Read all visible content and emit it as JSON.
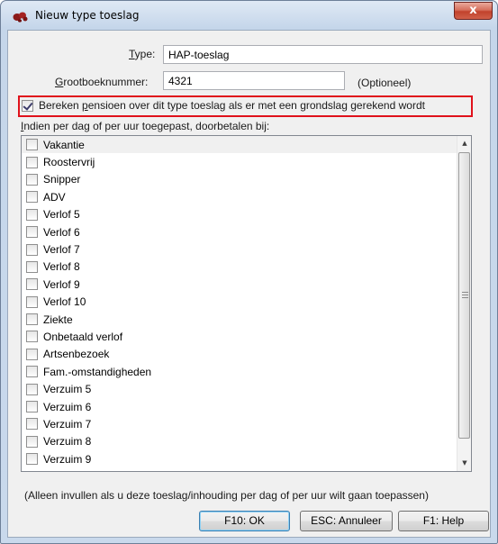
{
  "window": {
    "title": "Nieuw type toeslag",
    "close_symbol": "x"
  },
  "form": {
    "type_label_prefix": "T",
    "type_label_rest": "ype:",
    "type_value": "HAP-toeslag",
    "ledger_label_prefix": "G",
    "ledger_label_rest": "rootboeknummer:",
    "ledger_value": "4321",
    "ledger_hint": "(Optioneel)",
    "pension_checkbox": {
      "checked": true,
      "label_before": "Bereken ",
      "label_accel": "p",
      "label_after": "ensioen over dit type toeslag als er met een grondslag gerekend wordt"
    },
    "list_caption_prefix": "I",
    "list_caption_rest": "ndien per dag of per uur toegepast, doorbetalen bij:"
  },
  "leave_types": [
    {
      "label": "Vakantie",
      "checked": false
    },
    {
      "label": "Roostervrij",
      "checked": false
    },
    {
      "label": "Snipper",
      "checked": false
    },
    {
      "label": "ADV",
      "checked": false
    },
    {
      "label": "Verlof 5",
      "checked": false
    },
    {
      "label": "Verlof 6",
      "checked": false
    },
    {
      "label": "Verlof 7",
      "checked": false
    },
    {
      "label": "Verlof 8",
      "checked": false
    },
    {
      "label": "Verlof 9",
      "checked": false
    },
    {
      "label": "Verlof 10",
      "checked": false
    },
    {
      "label": "Ziekte",
      "checked": false
    },
    {
      "label": "Onbetaald verlof",
      "checked": false
    },
    {
      "label": "Artsenbezoek",
      "checked": false
    },
    {
      "label": "Fam.-omstandigheden",
      "checked": false
    },
    {
      "label": "Verzuim 5",
      "checked": false
    },
    {
      "label": "Verzuim 6",
      "checked": false
    },
    {
      "label": "Verzuim 7",
      "checked": false
    },
    {
      "label": "Verzuim 8",
      "checked": false
    },
    {
      "label": "Verzuim 9",
      "checked": false
    }
  ],
  "footer_note": "(Alleen invullen als u deze toeslag/inhouding per dag of per uur wilt gaan toepassen)",
  "buttons": {
    "ok": "F10: OK",
    "cancel": "ESC: Annuleer",
    "help": "F1: Help"
  },
  "colors": {
    "highlight_border": "#e0111b",
    "app_icon": "#8b1a1a"
  },
  "icons": {
    "app": "red-paw-icon",
    "scroll_up": "scroll-up-arrow-icon",
    "scroll_down": "scroll-down-arrow-icon"
  }
}
